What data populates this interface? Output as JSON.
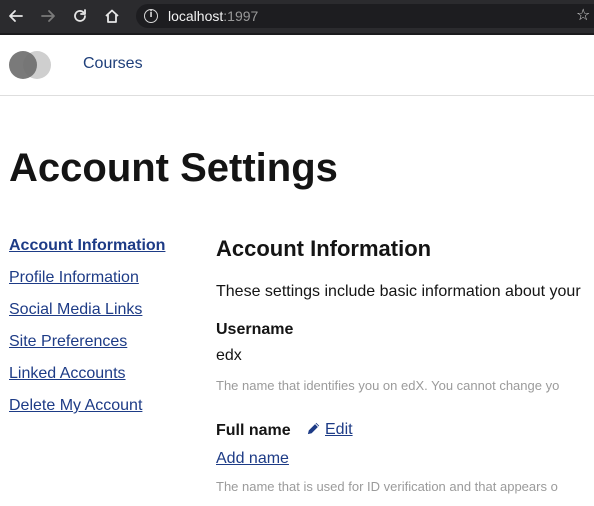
{
  "browser": {
    "url_host": "localhost",
    "url_port": ":1997",
    "icons": {
      "back": "arrow-left-icon",
      "forward": "arrow-right-icon",
      "reload": "reload-icon",
      "home": "home-icon",
      "info": "info-icon",
      "bookmark": "star-icon"
    }
  },
  "header": {
    "nav_courses": "Courses"
  },
  "page": {
    "title": "Account Settings"
  },
  "sidebar": {
    "items": [
      {
        "label": "Account Information",
        "active": true
      },
      {
        "label": "Profile Information",
        "active": false
      },
      {
        "label": "Social Media Links",
        "active": false
      },
      {
        "label": "Site Preferences",
        "active": false
      },
      {
        "label": "Linked Accounts",
        "active": false
      },
      {
        "label": "Delete My Account",
        "active": false
      }
    ]
  },
  "section": {
    "title": "Account Information",
    "description": "These settings include basic information about your",
    "username": {
      "label": "Username",
      "value": "edx",
      "help": "The name that identifies you on edX. You cannot change yo"
    },
    "full_name": {
      "label": "Full name",
      "edit_label": "Edit",
      "add_label": "Add name",
      "help": "The name that is used for ID verification and that appears o"
    }
  },
  "colors": {
    "link": "#1d3b86",
    "help_text": "#9b9b9b",
    "browser_bar": "#2b2b2e"
  }
}
